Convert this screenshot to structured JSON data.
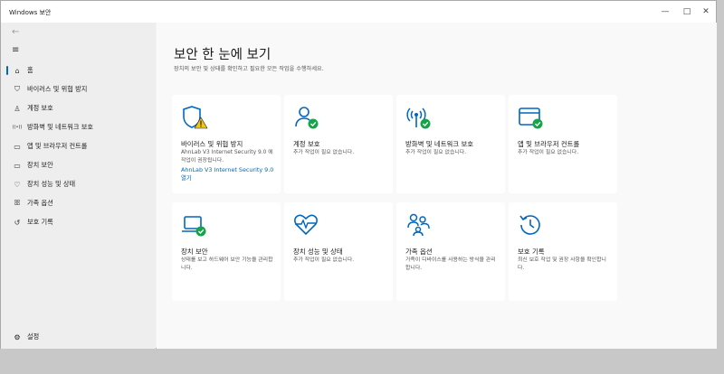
{
  "window": {
    "title": "Windows 보안",
    "minimize": "—",
    "maximize": "□",
    "close": "✕"
  },
  "sidebar": {
    "back": "←",
    "menu": "≡",
    "items": [
      {
        "label": "홈",
        "icon": "⌂"
      },
      {
        "label": "바이러스 및 위협 방지",
        "icon": "⛉"
      },
      {
        "label": "계정 보호",
        "icon": "♙"
      },
      {
        "label": "방화벽 및 네트워크 보호",
        "icon": "((•))"
      },
      {
        "label": "앱 및 브라우저 컨트롤",
        "icon": "▭"
      },
      {
        "label": "장치 보안",
        "icon": "▭"
      },
      {
        "label": "장치 성능 및 상태",
        "icon": "♡"
      },
      {
        "label": "가족 옵션",
        "icon": "ꕥ"
      },
      {
        "label": "보호 기록",
        "icon": "↺"
      }
    ],
    "settings": {
      "label": "설정",
      "icon": "⚙"
    }
  },
  "main": {
    "title": "보안 한 눈에 보기",
    "subtitle": "장치의 보안 및 상태를 확인하고 필요한 모든 작업을 수행하세요.",
    "cards": [
      {
        "title": "바이러스 및 위협 방지",
        "desc": "AhnLab V3 Internet Security 9.0 에 작업이 권장됩니다.",
        "link": "AhnLab V3 Internet Security 9.0 열기"
      },
      {
        "title": "계정 보호",
        "desc": "추가 작업이 필요 없습니다."
      },
      {
        "title": "방화벽 및 네트워크 보호",
        "desc": "추가 작업이 필요 없습니다."
      },
      {
        "title": "앱 및 브라우저 컨트롤",
        "desc": "추가 작업이 필요 없습니다."
      },
      {
        "title": "장치 보안",
        "desc": "상태를 보고 하드웨어 보안 기능을 관리합니다."
      },
      {
        "title": "장치 성능 및 상태",
        "desc": "추가 작업이 필요 없습니다."
      },
      {
        "title": "가족 옵션",
        "desc": "가족이 디바이스를 사용하는 방식을 관리합니다."
      },
      {
        "title": "보호 기록",
        "desc": "최신 보호 작업 및 권장 사항을 확인합니다."
      }
    ]
  },
  "colors": {
    "accent": "#0067c0",
    "ok": "#16a34a",
    "warning": "#f2c511"
  }
}
